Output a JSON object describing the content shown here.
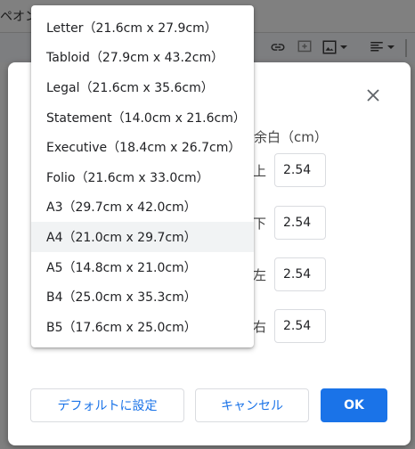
{
  "background": {
    "partial_text": "ペオン"
  },
  "dialog": {
    "margins": {
      "title": "余白（cm）",
      "rows": [
        {
          "label": "上",
          "value": "2.54"
        },
        {
          "label": "下",
          "value": "2.54"
        },
        {
          "label": "左",
          "value": "2.54"
        },
        {
          "label": "右",
          "value": "2.54"
        }
      ]
    },
    "buttons": {
      "default": "デフォルトに設定",
      "cancel": "キャンセル",
      "ok": "OK"
    }
  },
  "paper_size_menu": {
    "selected_index": 7,
    "items": [
      "Letter（21.6cm x 27.9cm）",
      "Tabloid（27.9cm x 43.2cm）",
      "Legal（21.6cm x 35.6cm）",
      "Statement（14.0cm x 21.6cm）",
      "Executive（18.4cm x 26.7cm）",
      "Folio（21.6cm x 33.0cm）",
      "A3（29.7cm x 42.0cm）",
      "A4（21.0cm x 29.7cm）",
      "A5（14.8cm x 21.0cm）",
      "B4（25.0cm x 35.3cm）",
      "B5（17.6cm x 25.0cm）"
    ]
  },
  "colors": {
    "accent": "#1a73e8",
    "selected_item_bg": "#f1f3f4",
    "overlay": "#7f7f7f"
  }
}
